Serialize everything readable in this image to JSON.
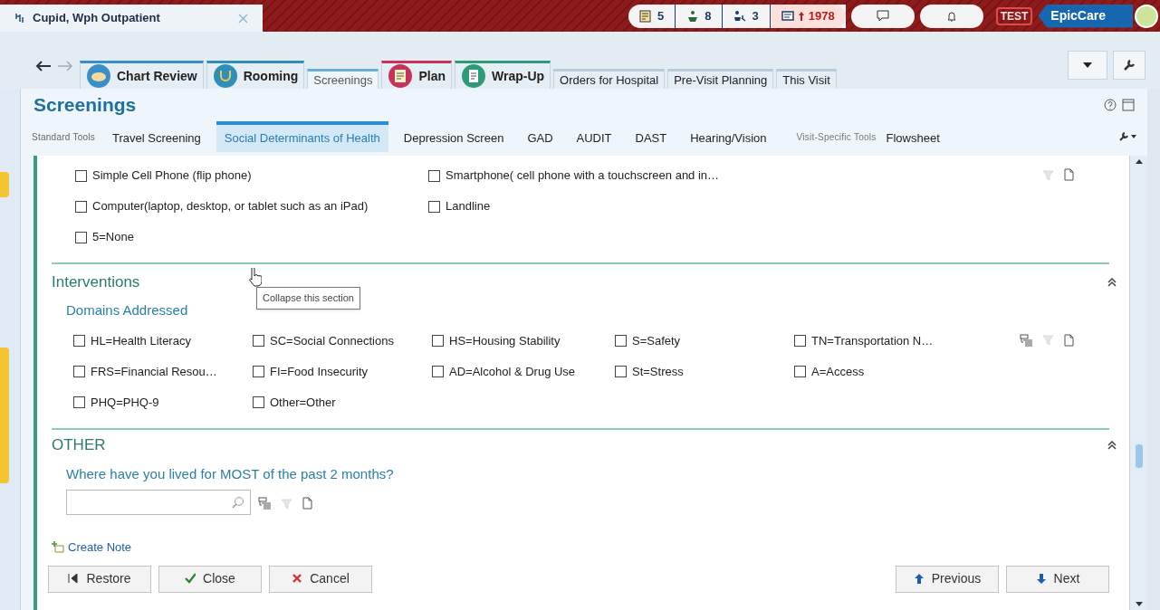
{
  "patient_tab": {
    "title": "Cupid, Wph Outpatient"
  },
  "header_badges": [
    {
      "kind": "inbox",
      "count": "5"
    },
    {
      "kind": "person",
      "count": "8"
    },
    {
      "kind": "group",
      "count": "3"
    },
    {
      "kind": "alert",
      "count": "1978"
    },
    {
      "kind": "chat"
    },
    {
      "kind": "bell"
    }
  ],
  "environment": "TEST",
  "app_name": "EpicCare",
  "activity_tabs": [
    {
      "label": "Chart Review",
      "selected": false,
      "color": "#3a8fc8"
    },
    {
      "label": "Rooming",
      "selected": false,
      "color": "#2f8fb8"
    },
    {
      "label": "Screenings",
      "selected": true
    },
    {
      "label": "Plan",
      "selected": false,
      "color": "#c8325a"
    },
    {
      "label": "Wrap-Up",
      "selected": false,
      "color": "#2e9a78"
    },
    {
      "label": "Orders for Hospital",
      "selected": false
    },
    {
      "label": "Pre-Visit Planning",
      "selected": false
    },
    {
      "label": "This Visit",
      "selected": false
    }
  ],
  "activity_title": "Screenings",
  "toolbar": {
    "standard_label": "Standard Tools",
    "standard_tools": [
      {
        "label": "Travel Screening",
        "selected": false
      },
      {
        "label": "Social Determinants of Health",
        "selected": true
      },
      {
        "label": "Depression Screen",
        "selected": false
      },
      {
        "label": "GAD",
        "selected": false
      },
      {
        "label": "AUDIT",
        "selected": false
      },
      {
        "label": "DAST",
        "selected": false
      },
      {
        "label": "Hearing/Vision",
        "selected": false
      }
    ],
    "visit_label": "Visit-Specific Tools",
    "visit_tools": [
      {
        "label": "Flowsheet",
        "selected": false
      }
    ]
  },
  "sections": [
    {
      "kind": "options",
      "options": [
        {
          "label": "Simple Cell Phone (flip phone)",
          "checked": false
        },
        {
          "label": "Smartphone( cell phone with a touchscreen and in…",
          "checked": false
        },
        {
          "label": "Computer(laptop, desktop, or tablet such as an iPad)",
          "checked": false
        },
        {
          "label": "Landline",
          "checked": false
        },
        {
          "label": "5=None",
          "checked": false
        }
      ]
    },
    {
      "kind": "group",
      "title": "Interventions",
      "collapse_tooltip": "Collapse this section",
      "subtitle": "Domains Addressed",
      "options": [
        {
          "label": "HL=Health Literacy",
          "checked": false
        },
        {
          "label": "SC=Social Connections",
          "checked": false
        },
        {
          "label": "HS=Housing Stability",
          "checked": false
        },
        {
          "label": "S=Safety",
          "checked": false
        },
        {
          "label": "TN=Transportation N…",
          "checked": false
        },
        {
          "label": "FRS=Financial Resou…",
          "checked": false
        },
        {
          "label": "FI=Food Insecurity",
          "checked": false
        },
        {
          "label": "AD=Alcohol & Drug Use",
          "checked": false
        },
        {
          "label": "St=Stress",
          "checked": false
        },
        {
          "label": "A=Access",
          "checked": false
        },
        {
          "label": "PHQ=PHQ-9",
          "checked": false
        },
        {
          "label": "Other=Other",
          "checked": false
        }
      ]
    },
    {
      "kind": "question",
      "title": "OTHER",
      "question": "Where have you lived for MOST of the past 2 months?"
    }
  ],
  "create_note": "Create Note",
  "left_buttons": [
    {
      "kind": "restore",
      "label": "Restore"
    },
    {
      "kind": "close",
      "label": "Close"
    },
    {
      "kind": "cancel",
      "label": "Cancel"
    }
  ],
  "right_buttons": [
    {
      "kind": "previous",
      "label": "Previous"
    },
    {
      "kind": "next",
      "label": "Next"
    }
  ]
}
